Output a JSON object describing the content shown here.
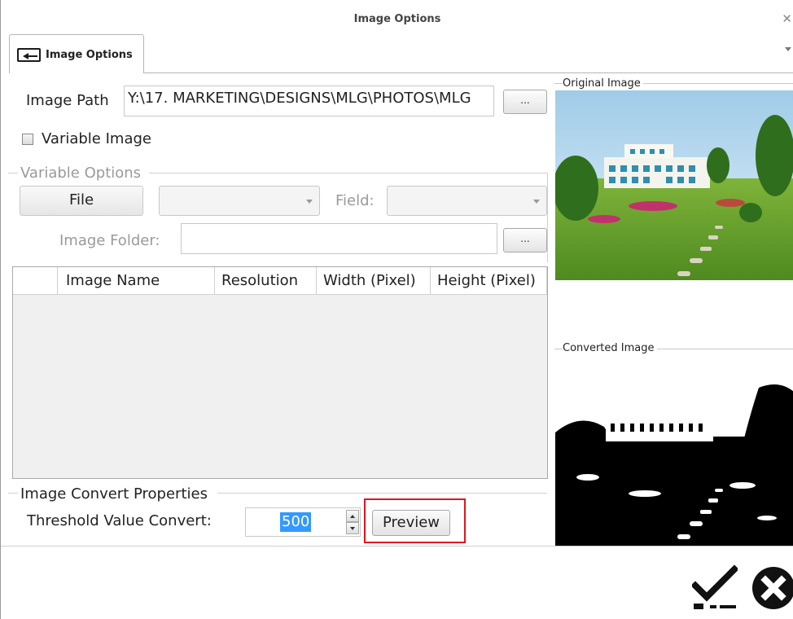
{
  "window": {
    "title": "Image Options",
    "close_glyph": "✕"
  },
  "tab": {
    "label": "Image Options",
    "icon": "image-icon"
  },
  "image_path": {
    "label": "Image Path",
    "value": "Y:\\17. MARKETING\\DESIGNS\\MLG\\PHOTOS\\MLG",
    "browse_label": "..."
  },
  "variable_image": {
    "label": "Variable Image",
    "checked": false
  },
  "variable_options": {
    "title": "Variable Options",
    "file_button": "File",
    "field_label": "Field:",
    "image_folder_label": "Image Folder:",
    "image_folder_value": "",
    "browse_label": "..."
  },
  "grid": {
    "columns": [
      "Image Name",
      "Resolution",
      "Width (Pixel)",
      "Height (Pixel)"
    ],
    "rows": []
  },
  "convert": {
    "title": "Image Convert Properties",
    "threshold_label": "Threshold Value Convert:",
    "threshold_value": "500",
    "preview_button": "Preview"
  },
  "images": {
    "original_label": "Original Image",
    "converted_label": "Converted Image"
  },
  "actions": {
    "ok_icon": "checkmark-icon",
    "cancel_icon": "close-circle-icon"
  },
  "colors": {
    "highlight": "#e0141e",
    "selection": "#3399ff"
  }
}
